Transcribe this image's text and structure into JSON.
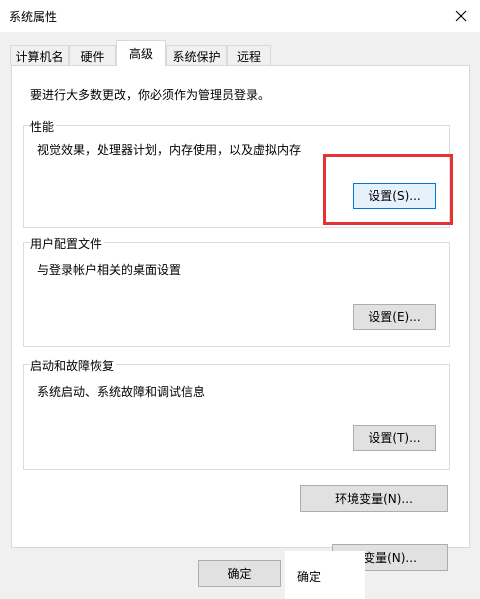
{
  "window": {
    "title": "系统属性",
    "close_icon": "close-icon"
  },
  "tabs": [
    {
      "label": "计算机名"
    },
    {
      "label": "硬件"
    },
    {
      "label": "高级",
      "active": true
    },
    {
      "label": "系统保护"
    },
    {
      "label": "远程"
    }
  ],
  "admin_note": "要进行大多数更改，你必须作为管理员登录。",
  "performance": {
    "title": "性能",
    "description": "视觉效果，处理器计划，内存使用，以及虚拟内存",
    "settings_button": "设置(S)..."
  },
  "user_profiles": {
    "title": "用户配置文件",
    "description": "与登录帐户相关的桌面设置",
    "settings_button": "设置(E)..."
  },
  "startup_recovery": {
    "title": "启动和故障恢复",
    "description": "系统启动、系统故障和调试信息",
    "settings_button": "设置(T)..."
  },
  "env_vars_button": "环境变量(N)...",
  "overlap": {
    "partial_button": "变量(N)...",
    "ok_label": "确定"
  },
  "footer": {
    "ok_button": "确定"
  },
  "colors": {
    "highlight_box": "#e53232",
    "focus_border": "#0078d7"
  }
}
